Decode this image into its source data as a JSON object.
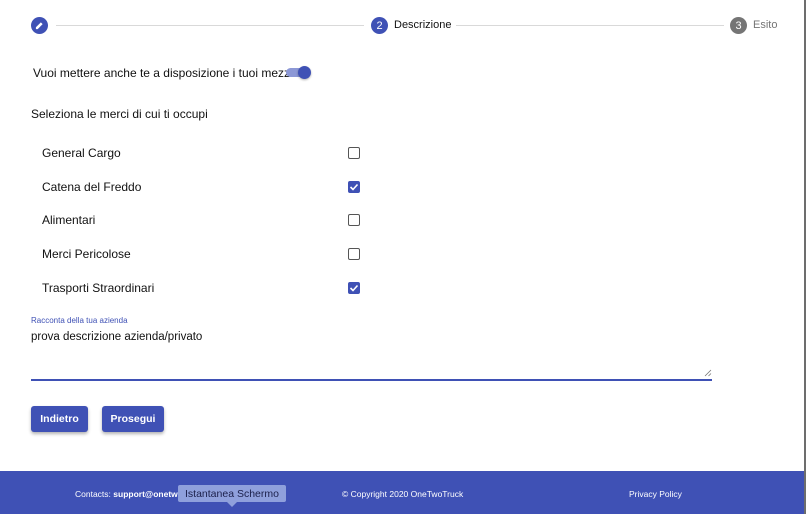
{
  "stepper": {
    "steps": [
      {
        "number": "2",
        "label": "Descrizione"
      },
      {
        "number": "3",
        "label": "Esito"
      }
    ],
    "active_color": "#3f51b5",
    "inactive_color": "#757575"
  },
  "share_vehicles": {
    "question": "Vuoi mettere anche te a disposizione i tuoi mezzi?",
    "enabled": true
  },
  "goods": {
    "title": "Seleziona le merci di cui ti occupi",
    "items": [
      {
        "label": "General Cargo",
        "checked": false
      },
      {
        "label": "Catena del Freddo",
        "checked": true
      },
      {
        "label": "Alimentari",
        "checked": false
      },
      {
        "label": "Merci Pericolose",
        "checked": false
      },
      {
        "label": "Trasporti Straordinari",
        "checked": true
      }
    ]
  },
  "description": {
    "label": "Racconta della tua azienda",
    "value": "prova descrizione azienda/privato"
  },
  "buttons": {
    "back": "Indietro",
    "next": "Prosegui"
  },
  "footer": {
    "contacts_label": "Contacts:",
    "contacts_email": "support@onetw",
    "copyright": "© Copyright 2020 OneTwoTruck",
    "privacy": "Privacy Policy",
    "background": "#3f51b5"
  },
  "tooltip": {
    "text": "Istantanea Schermo"
  }
}
